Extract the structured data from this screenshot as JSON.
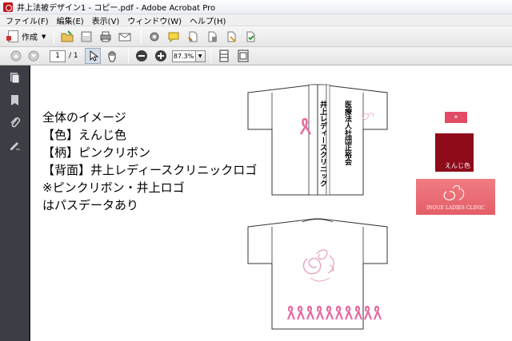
{
  "window": {
    "title": "井上法被デザイン1 - コピー.pdf - Adobe Acrobat Pro"
  },
  "menu": {
    "items": [
      "ファイル(F)",
      "編集(E)",
      "表示(V)",
      "ウィンドウ(W)",
      "ヘルプ(H)"
    ]
  },
  "toolbar": {
    "create_label": "作成"
  },
  "nav": {
    "page_current": "1",
    "page_total": "/ 1",
    "zoom": "87.3%"
  },
  "document": {
    "description": [
      "全体のイメージ",
      "【色】えんじ色",
      "【柄】ピンクリボン",
      "【背面】井上レディースクリニックロゴ",
      "※ピンクリボン・井上ロゴ",
      "はパスデータあり"
    ],
    "collar_right": "医療法人社団正裕会",
    "collar_left": "井上レディースクリニック",
    "swatch_color_label": "えんじ色",
    "logo_text": "INOUE LADIES CLINIC"
  },
  "colors": {
    "enji": "#8e0b1a",
    "pink_ribbon": "#e868a0",
    "logo_bg": "#e86870"
  }
}
